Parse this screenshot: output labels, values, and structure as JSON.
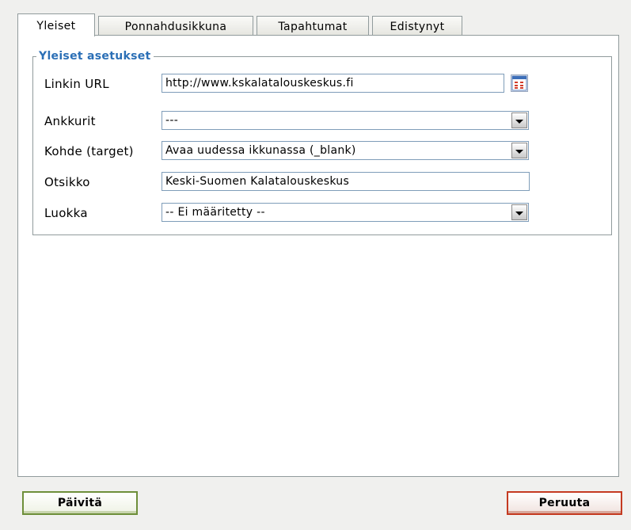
{
  "tabs": [
    {
      "label": "Yleiset",
      "active": true
    },
    {
      "label": "Ponnahdusikkuna",
      "active": false
    },
    {
      "label": "Tapahtumat",
      "active": false
    },
    {
      "label": "Edistynyt",
      "active": false
    }
  ],
  "general": {
    "legend": "Yleiset asetukset",
    "url_label": "Linkin URL",
    "url_value": "http://www.kskalatalouskeskus.fi",
    "anchors_label": "Ankkurit",
    "anchors_value": "---",
    "target_label": "Kohde (target)",
    "target_value": "Avaa uudessa ikkunassa (_blank)",
    "title_label": "Otsikko",
    "title_value": "Keski-Suomen Kalatalouskeskus",
    "class_label": "Luokka",
    "class_value": "-- Ei määritetty --"
  },
  "buttons": {
    "update": "Päivitä",
    "cancel": "Peruuta"
  },
  "icons": {
    "browse": "link-browser-icon"
  },
  "colors": {
    "legend": "#2b6fb6",
    "update_border": "#6e8f3a",
    "cancel_border": "#c43a20"
  }
}
